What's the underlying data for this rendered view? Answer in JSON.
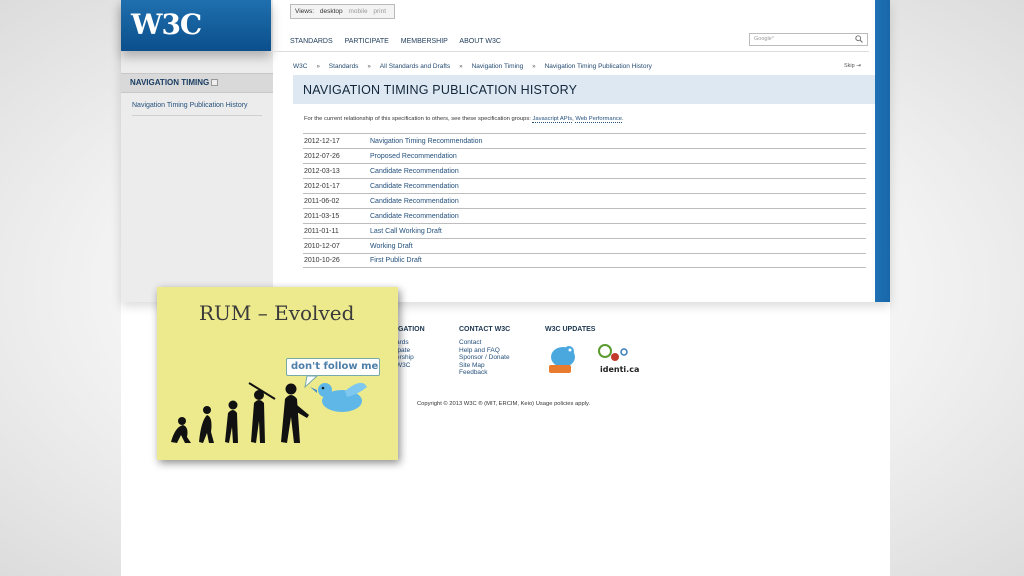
{
  "logo": "W3C",
  "views": {
    "label": "Views:",
    "desktop": "desktop",
    "mobile": "mobile",
    "print": "print"
  },
  "topnav": [
    "STANDARDS",
    "PARTICIPATE",
    "MEMBERSHIP",
    "ABOUT W3C"
  ],
  "search": {
    "placeholder": "Google°"
  },
  "sidebar": {
    "heading": "NAVIGATION TIMING",
    "item": "Navigation Timing Publication History"
  },
  "breadcrumb": [
    "W3C",
    "Standards",
    "All Standards and Drafts",
    "Navigation Timing",
    "Navigation Timing Publication History"
  ],
  "breadcrumb_sep": "»",
  "skip": "Skip",
  "title": "NAVIGATION TIMING PUBLICATION HISTORY",
  "intro": {
    "text": "For the current relationship of this specification to others, see these specification groups: ",
    "link1": "Javascript APIs",
    "link2": "Web Performance"
  },
  "history": [
    {
      "date": "2012-12-17",
      "status": "Navigation Timing Recommendation"
    },
    {
      "date": "2012-07-26",
      "status": "Proposed Recommendation"
    },
    {
      "date": "2012-03-13",
      "status": "Candidate Recommendation"
    },
    {
      "date": "2012-01-17",
      "status": "Candidate Recommendation"
    },
    {
      "date": "2011-06-02",
      "status": "Candidate Recommendation"
    },
    {
      "date": "2011-03-15",
      "status": "Candidate Recommendation"
    },
    {
      "date": "2011-01-11",
      "status": "Last Call Working Draft"
    },
    {
      "date": "2010-12-07",
      "status": "Working Draft"
    },
    {
      "date": "2010-10-26",
      "status": "First Public Draft"
    }
  ],
  "footer": {
    "nav": {
      "heading": "IGATION",
      "items": [
        "ards",
        "ipate",
        "ership",
        "W3C"
      ]
    },
    "contact": {
      "heading": "CONTACT W3C",
      "items": [
        "Contact",
        "Help and FAQ",
        "Sponsor / Donate",
        "Site Map",
        "Feedback"
      ]
    },
    "updates": {
      "heading": "W3C UPDATES",
      "identica": "identi.ca"
    },
    "copyright": "Copyright © 2013 W3C ® (MIT, ERCIM, Keio) Usage policies apply."
  },
  "slide": {
    "title": "RUM – Evolved",
    "bubble": "don't follow me"
  },
  "colors": {
    "brand_blue": "#0b4f8c",
    "link": "#24507c",
    "slide_bg": "#ecea8c"
  }
}
